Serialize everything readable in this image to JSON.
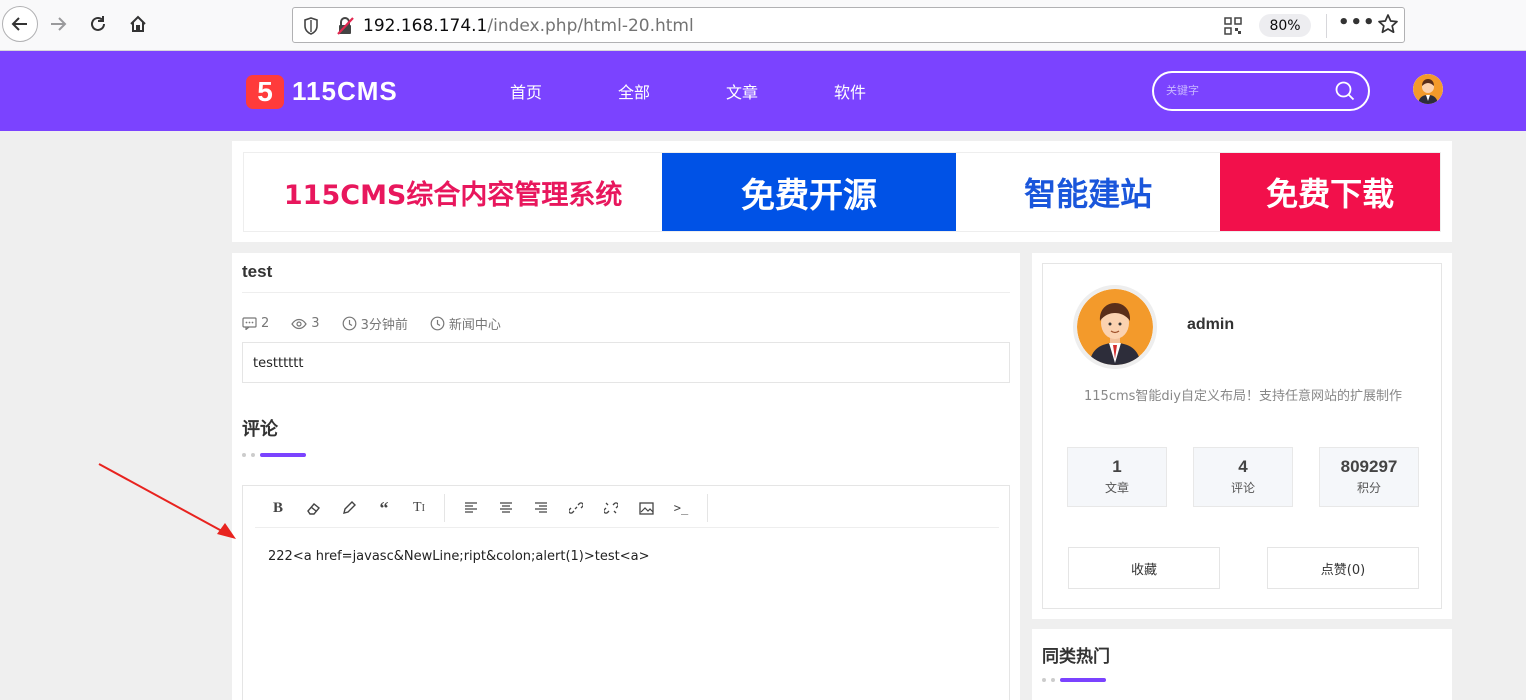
{
  "browser": {
    "url_host": "192.168.174.1",
    "url_path": "/index.php/html-20.html",
    "zoom": "80%"
  },
  "site": {
    "logo_mark": "5",
    "logo_text": "115CMS",
    "nav": [
      "首页",
      "全部",
      "文章",
      "软件"
    ],
    "search_placeholder": "关键字",
    "brand_color": "#7b43ff"
  },
  "banner": {
    "segments": [
      "115CMS综合内容管理系统",
      "免费开源",
      "智能建站",
      "免费下载"
    ]
  },
  "article": {
    "title": "test",
    "meta": {
      "comments": "2",
      "views": "3",
      "time": "3分钟前",
      "category": "新闻中心"
    },
    "body": "testttttt"
  },
  "comments": {
    "heading": "评论",
    "toolbar": [
      "bold",
      "eraser",
      "pencil",
      "quote",
      "text-size",
      "align-left",
      "align-center",
      "align-right",
      "link",
      "unlink",
      "image",
      "code"
    ],
    "content": "222<a href=javasc&NewLine;ript&colon;alert(1)>test<a>"
  },
  "profile": {
    "name": "admin",
    "desc": "115cms智能diy自定义布局！支持任意网站的扩展制作",
    "stats": [
      {
        "value": "1",
        "label": "文章"
      },
      {
        "value": "4",
        "label": "评论"
      },
      {
        "value": "809297",
        "label": "积分"
      }
    ],
    "buttons": [
      "收藏",
      "点赞(0)"
    ]
  },
  "hot": {
    "title": "同类热门"
  }
}
